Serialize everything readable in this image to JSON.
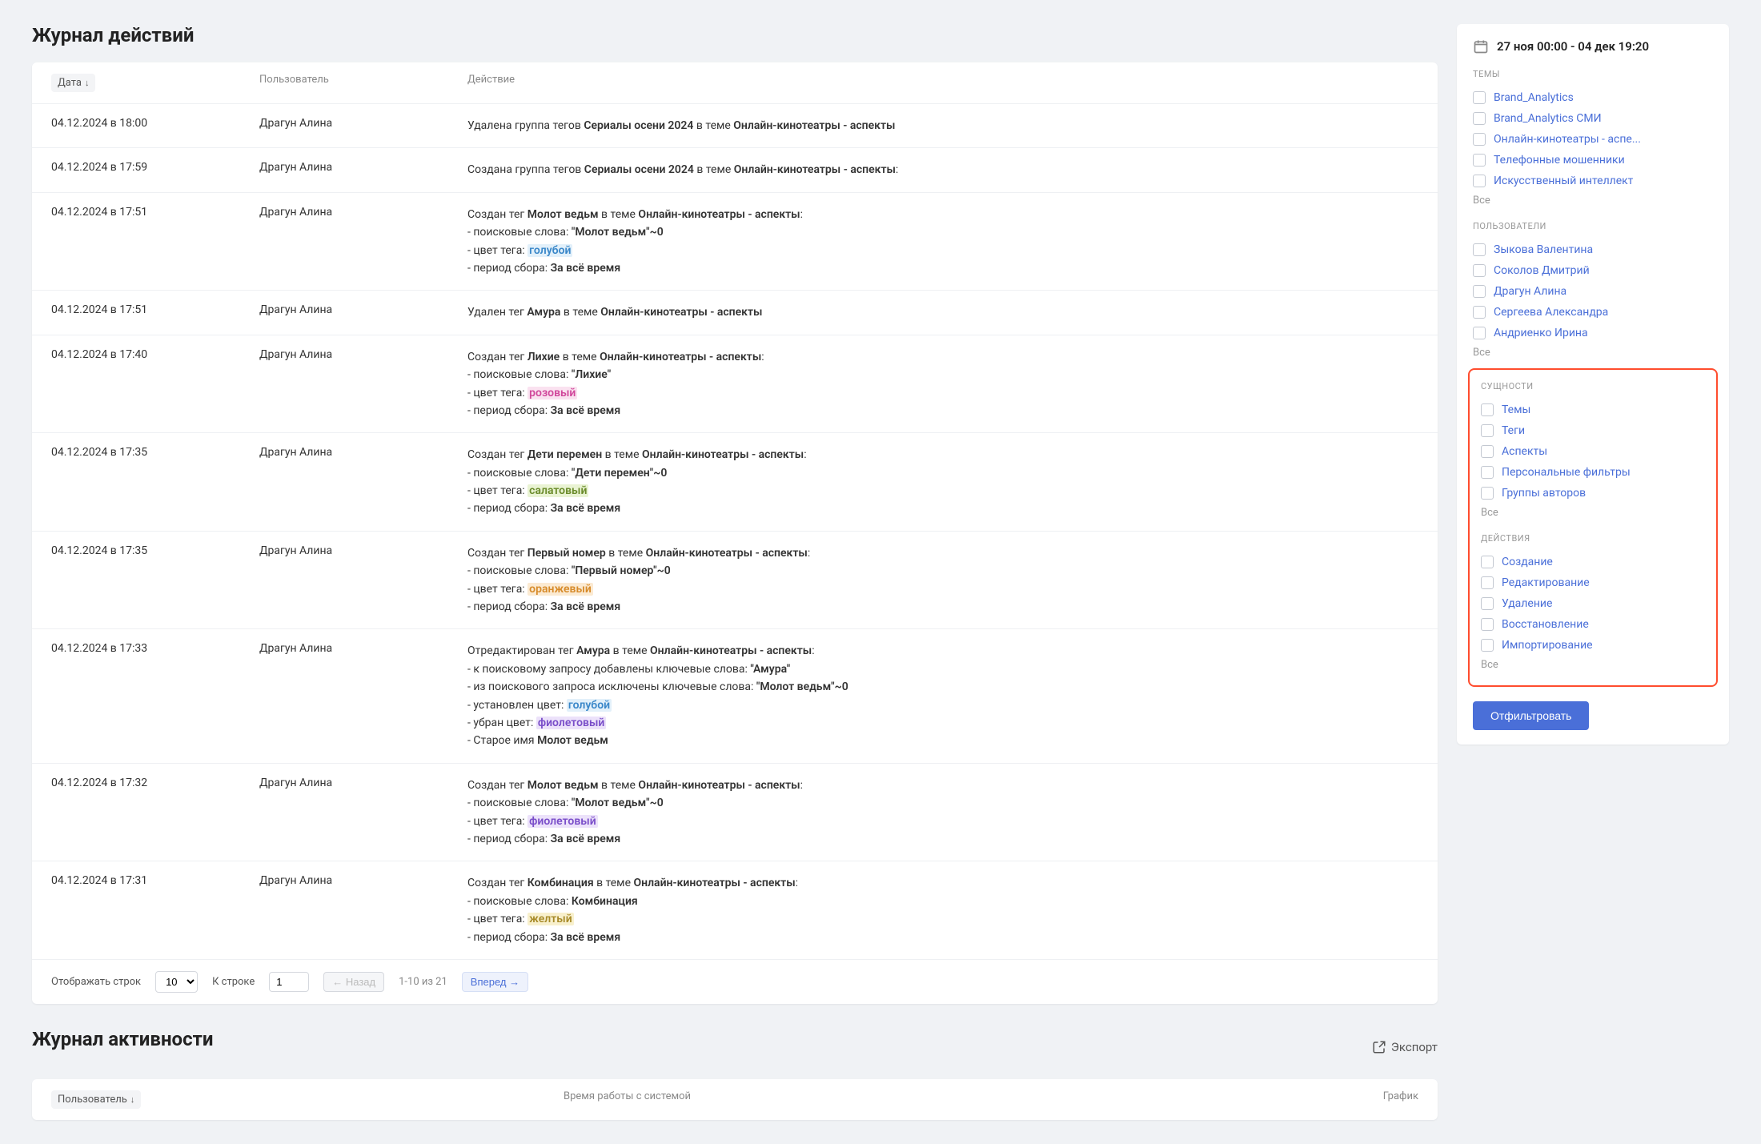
{
  "page_title": "Журнал действий",
  "table": {
    "headers": {
      "date": "Дата",
      "user": "Пользователь",
      "action": "Действие"
    },
    "rows": [
      {
        "date": "04.12.2024 в 18:00",
        "user": "Драгун Алина",
        "action_html": "Удалена группа тегов <b>Сериалы осени 2024</b> в теме <b>Онлайн-кинотеатры - аспекты</b>"
      },
      {
        "date": "04.12.2024 в 17:59",
        "user": "Драгун Алина",
        "action_html": "Создана группа тегов <b>Сериалы осени 2024</b> в теме <b>Онлайн-кинотеатры - аспекты</b>:"
      },
      {
        "date": "04.12.2024 в 17:51",
        "user": "Драгун Алина",
        "action_html": "Создан тег <b>Молот ведьм</b> в теме <b>Онлайн-кинотеатры - аспекты</b>:<br>- поисковые слова: <b>\"Молот ведьм\"~0</b><br>- цвет тега: <span class='tag-color c-blue'>голубой</span><br>- период сбора: <b>За всё время</b>"
      },
      {
        "date": "04.12.2024 в 17:51",
        "user": "Драгун Алина",
        "action_html": "Удален тег <b>Амура</b> в теме <b>Онлайн-кинотеатры - аспекты</b>"
      },
      {
        "date": "04.12.2024 в 17:40",
        "user": "Драгун Алина",
        "action_html": "Создан тег <b>Лихие</b> в теме <b>Онлайн-кинотеатры - аспекты</b>:<br>- поисковые слова: <b>\"Лихие\"</b><br>- цвет тега: <span class='tag-color c-pink'>розовый</span><br>- период сбора: <b>За всё время</b>"
      },
      {
        "date": "04.12.2024 в 17:35",
        "user": "Драгун Алина",
        "action_html": "Создан тег <b>Дети перемен</b> в теме <b>Онлайн-кинотеатры - аспекты</b>:<br>- поисковые слова: <b>\"Дети перемен\"~0</b><br>- цвет тега: <span class='tag-color c-lime'>салатовый</span><br>- период сбора: <b>За всё время</b>"
      },
      {
        "date": "04.12.2024 в 17:35",
        "user": "Драгун Алина",
        "action_html": "Создан тег <b>Первый номер</b> в теме <b>Онлайн-кинотеатры - аспекты</b>:<br>- поисковые слова: <b>\"Первый номер\"~0</b><br>- цвет тега: <span class='tag-color c-orange'>оранжевый</span><br>- период сбора: <b>За всё время</b>"
      },
      {
        "date": "04.12.2024 в 17:33",
        "user": "Драгун Алина",
        "action_html": "Отредактирован тег <b>Амура</b> в теме <b>Онлайн-кинотеатры - аспекты</b>:<br>- к поисковому запросу добавлены ключевые слова: <b>\"Амура\"</b><br>- из поискового запроса исключены ключевые слова: <b>\"Молот ведьм\"~0</b><br>- установлен цвет: <span class='tag-color c-blue'>голубой</span><br>- убран цвет: <span class='tag-color c-violet'>фиолетовый</span><br>- Старое имя <b>Молот ведьм</b>"
      },
      {
        "date": "04.12.2024 в 17:32",
        "user": "Драгун Алина",
        "action_html": "Создан тег <b>Молот ведьм</b> в теме <b>Онлайн-кинотеатры - аспекты</b>:<br>- поисковые слова: <b>\"Молот ведьм\"~0</b><br>- цвет тега: <span class='tag-color c-violet'>фиолетовый</span><br>- период сбора: <b>За всё время</b>"
      },
      {
        "date": "04.12.2024 в 17:31",
        "user": "Драгун Алина",
        "action_html": "Создан тег <b>Комбинация</b> в теме <b>Онлайн-кинотеатры - аспекты</b>:<br>- поисковые слова: <b>Комбинация</b><br>- цвет тега: <span class='tag-color c-yellow'>желтый</span><br>- период сбора: <b>За всё время</b>"
      }
    ]
  },
  "pagination": {
    "rows_label": "Отображать строк",
    "rows_value": "10",
    "goto_label": "К строке",
    "goto_value": "1",
    "back": "← Назад",
    "range": "1-10 из 21",
    "forward": "Вперед →"
  },
  "activity": {
    "title": "Журнал активности",
    "export": "Экспорт",
    "headers": {
      "user": "Пользователь",
      "time": "Время работы с системой",
      "chart": "График"
    }
  },
  "sidebar": {
    "date_range": "27 ноя 00:00 - 04 дек 19:20",
    "all": "Все",
    "filter_btn": "Отфильтровать",
    "groups": {
      "themes": {
        "title": "ТЕМЫ",
        "items": [
          "Brand_Analytics",
          "Brand_Analytics СМИ",
          "Онлайн-кинотеатры - аспе...",
          "Телефонные мошенники",
          "Искусственный интеллект"
        ]
      },
      "users": {
        "title": "ПОЛЬЗОВАТЕЛИ",
        "items": [
          "Зыкова Валентина",
          "Соколов Дмитрий",
          "Драгун Алина",
          "Сергеева Александра",
          "Андриенко Ирина"
        ]
      },
      "entities": {
        "title": "СУЩНОСТИ",
        "items": [
          "Темы",
          "Теги",
          "Аспекты",
          "Персональные фильтры",
          "Группы авторов"
        ]
      },
      "actions": {
        "title": "ДЕЙСТВИЯ",
        "items": [
          "Создание",
          "Редактирование",
          "Удаление",
          "Восстановление",
          "Импортирование"
        ]
      }
    }
  }
}
